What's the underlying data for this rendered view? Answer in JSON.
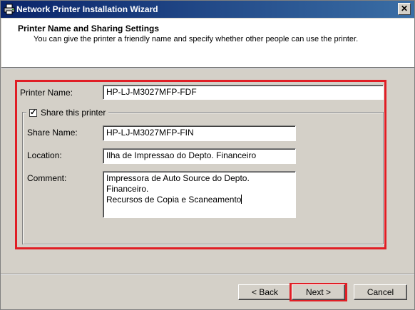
{
  "window": {
    "title": "Network Printer Installation Wizard",
    "close_label": "✕"
  },
  "header": {
    "title": "Printer Name and Sharing Settings",
    "subtitle": "You can give the printer a friendly name and specify whether other people can use the printer."
  },
  "form": {
    "printer_name_label": "Printer Name:",
    "printer_name_value": "HP-LJ-M3027MFP-FDF",
    "share_label": "Share this printer",
    "share_checked": true,
    "share_name_label": "Share Name:",
    "share_name_value": "HP-LJ-M3027MFP-FIN",
    "location_label": "Location:",
    "location_value": "Ilha de Impressao do Depto. Financeiro",
    "comment_label": "Comment:",
    "comment_value": "Impressora de Auto Source do Depto. Financeiro.\nRecursos de Copia e Scaneamento"
  },
  "buttons": {
    "back": "< Back",
    "next": "Next >",
    "cancel": "Cancel"
  },
  "colors": {
    "highlight": "#e01e25",
    "titlebar_start": "#0a246a",
    "titlebar_end": "#3a6ea5"
  },
  "icons": {
    "title": "printer-icon",
    "checkbox": "check-mark-icon"
  }
}
